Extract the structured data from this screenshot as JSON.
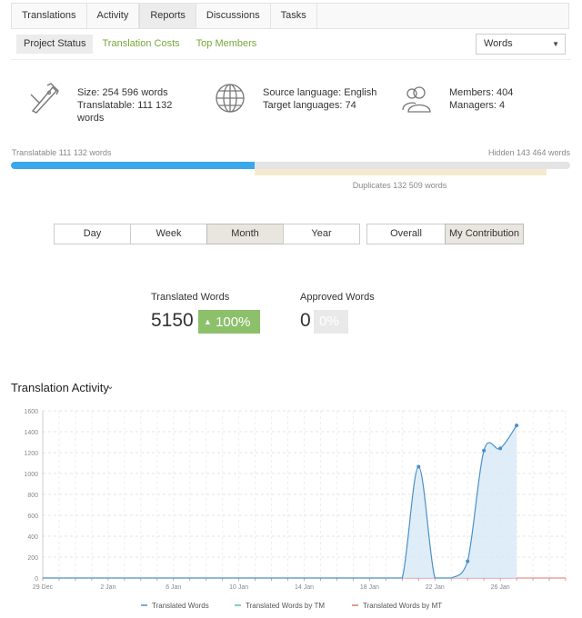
{
  "tabs": [
    "Translations",
    "Activity",
    "Reports",
    "Discussions",
    "Tasks"
  ],
  "active_tab": "Reports",
  "subtabs": [
    "Project Status",
    "Translation Costs",
    "Top Members"
  ],
  "active_subtab": "Project Status",
  "unit_select": {
    "value": "Words"
  },
  "stats": {
    "size": "Size: 254 596 words",
    "translatable_line1": "Translatable: 111 132",
    "translatable_line2": "words",
    "source_language": "Source language: English",
    "target_languages": "Target languages: 74",
    "members": "Members: 404",
    "managers": "Managers: 4"
  },
  "progress": {
    "translatable_label": "Translatable 111 132 words",
    "hidden_label": "Hidden 143 464 words",
    "duplicates_label": "Duplicates 132 509 words",
    "translatable_fraction": 0.4365,
    "duplicates_fraction": 0.5205
  },
  "periods": [
    "Day",
    "Week",
    "Month",
    "Year"
  ],
  "active_period": "Month",
  "scopes": [
    "Overall",
    "My Contribution"
  ],
  "active_scope": "My Contribution",
  "counters": {
    "translated": {
      "title": "Translated Words",
      "value": "5150",
      "delta": "100%",
      "delta_icon": "▲"
    },
    "approved": {
      "title": "Approved Words",
      "value": "0",
      "delta": "0%"
    }
  },
  "activity_title": "Translation Activity",
  "colors": {
    "accent_green": "#76a83a",
    "series_blue": "#4a90c8",
    "series_green": "#5cc0a0",
    "series_red": "#e07a5f"
  },
  "chart_data": {
    "type": "area",
    "title": "",
    "xlabel": "",
    "ylabel": "",
    "x_ticks": [
      "29 Dec",
      "2 Jan",
      "6 Jan",
      "10 Jan",
      "14 Jan",
      "18 Jan",
      "22 Jan",
      "26 Jan"
    ],
    "y_ticks": [
      0,
      200,
      400,
      600,
      800,
      1000,
      1200,
      1400,
      1600
    ],
    "ylim": [
      0,
      1600
    ],
    "xlim": [
      "29 Dec",
      "30 Jan"
    ],
    "grid": true,
    "legend_position": "bottom",
    "legend": [
      "Translated Words",
      "Translated Words by TM",
      "Translated Words by MT"
    ],
    "series": [
      {
        "name": "Translated Words",
        "points": [
          {
            "x": "29 Dec",
            "y": 0
          },
          {
            "x": "30 Dec",
            "y": 0
          },
          {
            "x": "31 Dec",
            "y": 0
          },
          {
            "x": "1 Jan",
            "y": 0
          },
          {
            "x": "2 Jan",
            "y": 0
          },
          {
            "x": "3 Jan",
            "y": 0
          },
          {
            "x": "4 Jan",
            "y": 0
          },
          {
            "x": "5 Jan",
            "y": 0
          },
          {
            "x": "6 Jan",
            "y": 0
          },
          {
            "x": "7 Jan",
            "y": 0
          },
          {
            "x": "8 Jan",
            "y": 0
          },
          {
            "x": "9 Jan",
            "y": 0
          },
          {
            "x": "10 Jan",
            "y": 0
          },
          {
            "x": "11 Jan",
            "y": 0
          },
          {
            "x": "12 Jan",
            "y": 0
          },
          {
            "x": "13 Jan",
            "y": 0
          },
          {
            "x": "14 Jan",
            "y": 0
          },
          {
            "x": "15 Jan",
            "y": 0
          },
          {
            "x": "16 Jan",
            "y": 0
          },
          {
            "x": "17 Jan",
            "y": 0
          },
          {
            "x": "18 Jan",
            "y": 0
          },
          {
            "x": "19 Jan",
            "y": 0
          },
          {
            "x": "20 Jan",
            "y": 0
          },
          {
            "x": "21 Jan",
            "y": 1065
          },
          {
            "x": "22 Jan",
            "y": 0
          },
          {
            "x": "23 Jan",
            "y": 0
          },
          {
            "x": "24 Jan",
            "y": 160
          },
          {
            "x": "25 Jan",
            "y": 1220
          },
          {
            "x": "26 Jan",
            "y": 1240
          },
          {
            "x": "27 Jan",
            "y": 1460
          }
        ]
      },
      {
        "name": "Translated Words by TM",
        "points": []
      },
      {
        "name": "Translated Words by MT",
        "points": []
      }
    ]
  }
}
